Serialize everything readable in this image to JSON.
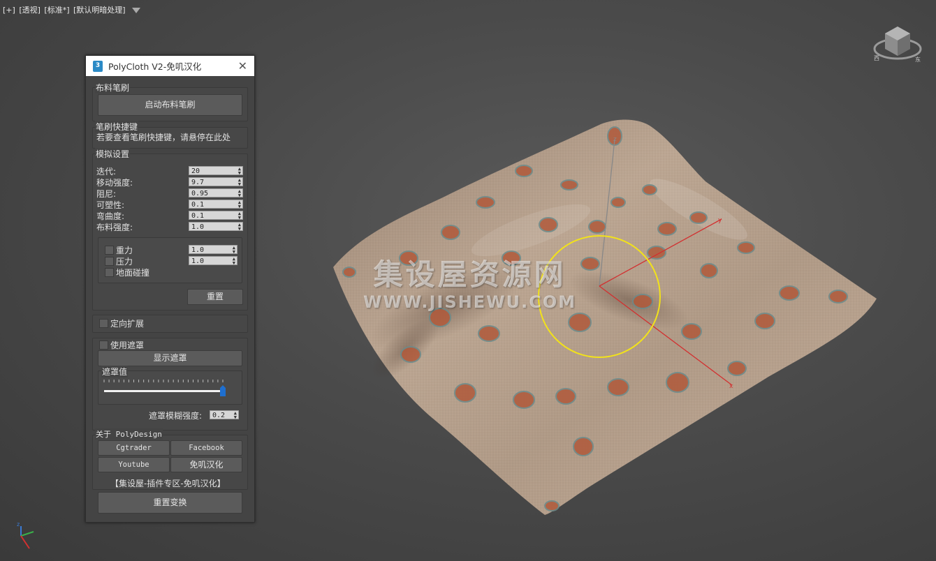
{
  "viewport": {
    "labels": [
      "[+]",
      "[透视]",
      "[标准*]",
      "[默认明暗处理]"
    ]
  },
  "watermark": {
    "line1": "集设屋资源网",
    "line2": "WWW.JISHEWU.COM"
  },
  "gizmo": {
    "x_label": "x",
    "y_label": "y",
    "z_label": "z"
  },
  "window": {
    "icon_text": "3",
    "title": "PolyCloth V2-免叽汉化"
  },
  "brush": {
    "group": "布料笔刷",
    "start_button": "启动布料笔刷"
  },
  "hotkeys": {
    "group": "笔刷快捷键",
    "hint": "若要查看笔刷快捷键，请悬停在此处"
  },
  "sim": {
    "group": "模拟设置",
    "params": [
      {
        "label": "迭代:",
        "value": "20"
      },
      {
        "label": "移动强度:",
        "value": "9.7"
      },
      {
        "label": "阻尼:",
        "value": "0.95"
      },
      {
        "label": "可塑性:",
        "value": "0.1"
      },
      {
        "label": "弯曲度:",
        "value": "0.1"
      },
      {
        "label": "布料强度:",
        "value": "1.0"
      }
    ],
    "forces": [
      {
        "label": "重力",
        "value": "1.0"
      },
      {
        "label": "压力",
        "value": "1.0"
      },
      {
        "label": "地面碰撞",
        "value": ""
      }
    ],
    "reset_button": "重置"
  },
  "directional": {
    "label": "定向扩展"
  },
  "mask": {
    "use_label": "使用遮罩",
    "show_button": "显示遮罩",
    "value_label": "遮罩值",
    "value": 1.0,
    "blur_label": "遮罩模糊强度:",
    "blur_value": "0.2"
  },
  "about": {
    "group": "关于 PolyDesign",
    "links": [
      "Cgtrader",
      "Facebook",
      "Youtube",
      "免叽汉化"
    ],
    "footer": "【集设屋-插件专区-免叽汉化】",
    "reset_transform": "重置变换"
  },
  "colors": {
    "cloth": "#b39c88",
    "brush_circle": "#f2e21a",
    "axis_red": "#d23030",
    "slider_handle": "#1e6fd0"
  }
}
